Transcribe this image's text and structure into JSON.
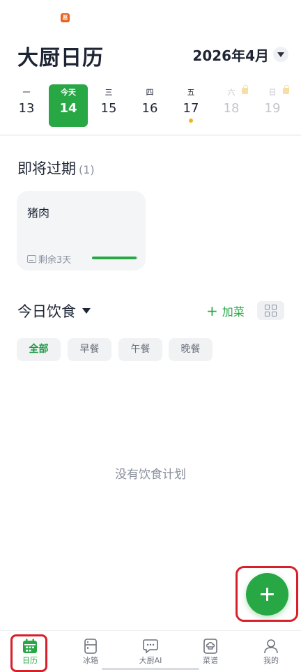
{
  "status_bar": {
    "app_icon_text": "恶"
  },
  "header": {
    "title": "大厨日历",
    "month": "2026年4月"
  },
  "week": {
    "days": [
      {
        "weekday": "一",
        "date": "13"
      },
      {
        "weekday": "今天",
        "date": "14"
      },
      {
        "weekday": "三",
        "date": "15"
      },
      {
        "weekday": "四",
        "date": "16"
      },
      {
        "weekday": "五",
        "date": "17"
      },
      {
        "weekday": "六",
        "date": "18"
      },
      {
        "weekday": "日",
        "date": "19"
      }
    ]
  },
  "expiring": {
    "title": "即将过期",
    "count": "(1)",
    "items": [
      {
        "name": "猪肉",
        "remaining": "剩余3天",
        "freshness": 0.97
      }
    ]
  },
  "diet": {
    "title": "今日饮食",
    "add_label": "加菜",
    "filters": [
      "全部",
      "早餐",
      "午餐",
      "晚餐"
    ],
    "empty_text": "没有饮食计划"
  },
  "tabs": [
    {
      "label": "日历"
    },
    {
      "label": "冰箱"
    },
    {
      "label": "大厨AI"
    },
    {
      "label": "菜谱"
    },
    {
      "label": "我的"
    }
  ],
  "colors": {
    "accent": "#28a745",
    "highlight": "#d8202a",
    "dot": "#f2b41b"
  },
  "icons": {
    "month_picker": "chevron-down-icon",
    "fab": "plus-icon",
    "tabs": [
      "calendar-icon",
      "fridge-icon",
      "chat-bubble-icon",
      "recipe-book-icon",
      "person-icon"
    ]
  }
}
